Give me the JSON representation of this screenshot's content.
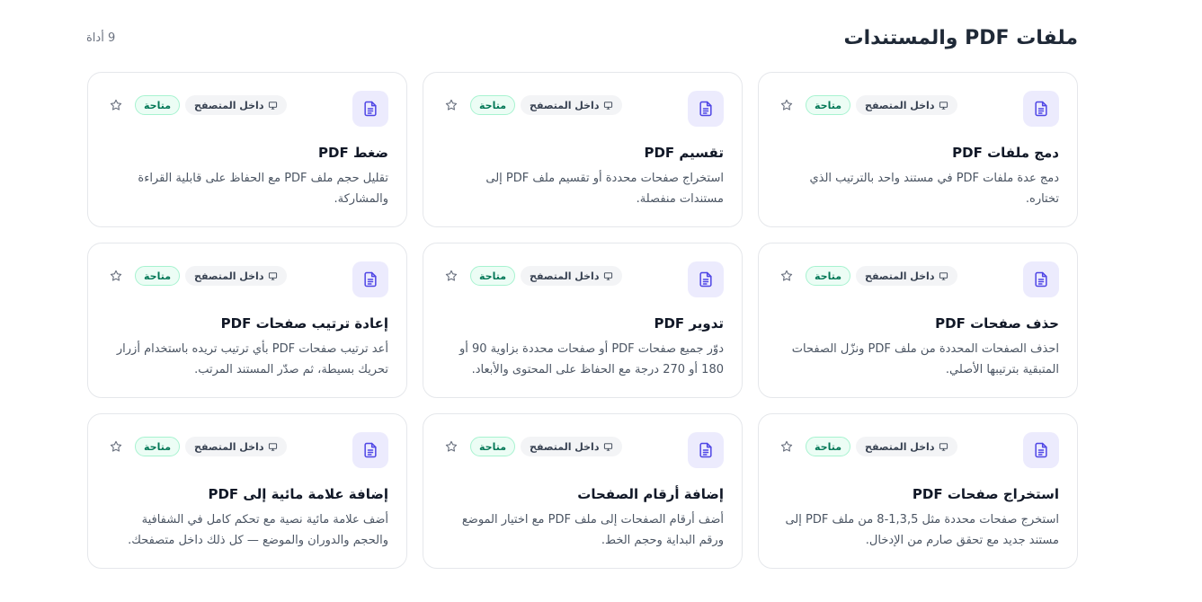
{
  "header": {
    "title": "ملفات PDF والمستندات",
    "count": "9 أداة"
  },
  "colors": {
    "accent": "#4f46e5",
    "icon_bg": "#ecebfd",
    "available_text": "#047857",
    "available_bg": "#ecfdf5"
  },
  "badges": {
    "browser_label": "داخل المتصفح",
    "browser_icon": "monitor-icon",
    "available_label": "متاحة"
  },
  "tools": [
    {
      "title": "دمج ملفات PDF",
      "description": "دمج عدة ملفات PDF في مستند واحد بالترتيب الذي تختاره.",
      "icon": "document-icon"
    },
    {
      "title": "تقسيم PDF",
      "description": "استخراج صفحات محددة أو تقسيم ملف PDF إلى مستندات منفصلة.",
      "icon": "document-icon"
    },
    {
      "title": "ضغط PDF",
      "description": "تقليل حجم ملف PDF مع الحفاظ على قابلية القراءة والمشاركة.",
      "icon": "document-icon"
    },
    {
      "title": "حذف صفحات PDF",
      "description": "احذف الصفحات المحددة من ملف PDF ونزّل الصفحات المتبقية بترتيبها الأصلي.",
      "icon": "document-icon"
    },
    {
      "title": "تدوير PDF",
      "description": "دوّر جميع صفحات PDF أو صفحات محددة بزاوية 90 أو 180 أو 270 درجة مع الحفاظ على المحتوى والأبعاد.",
      "icon": "document-icon"
    },
    {
      "title": "إعادة ترتيب صفحات PDF",
      "description": "أعد ترتيب صفحات PDF بأي ترتيب تريده باستخدام أزرار تحريك بسيطة، ثم صدّر المستند المرتب.",
      "icon": "document-icon"
    },
    {
      "title": "استخراج صفحات PDF",
      "description": "استخرج صفحات محددة مثل 1,3,5-8 من ملف PDF إلى مستند جديد مع تحقق صارم من الإدخال.",
      "icon": "document-icon"
    },
    {
      "title": "إضافة أرقام الصفحات",
      "description": "أضف أرقام الصفحات إلى ملف PDF مع اختيار الموضع ورقم البداية وحجم الخط.",
      "icon": "document-icon"
    },
    {
      "title": "إضافة علامة مائية إلى PDF",
      "description": "أضف علامة مائية نصية مع تحكم كامل في الشفافية والحجم والدوران والموضع — كل ذلك داخل متصفحك.",
      "icon": "document-icon"
    }
  ]
}
